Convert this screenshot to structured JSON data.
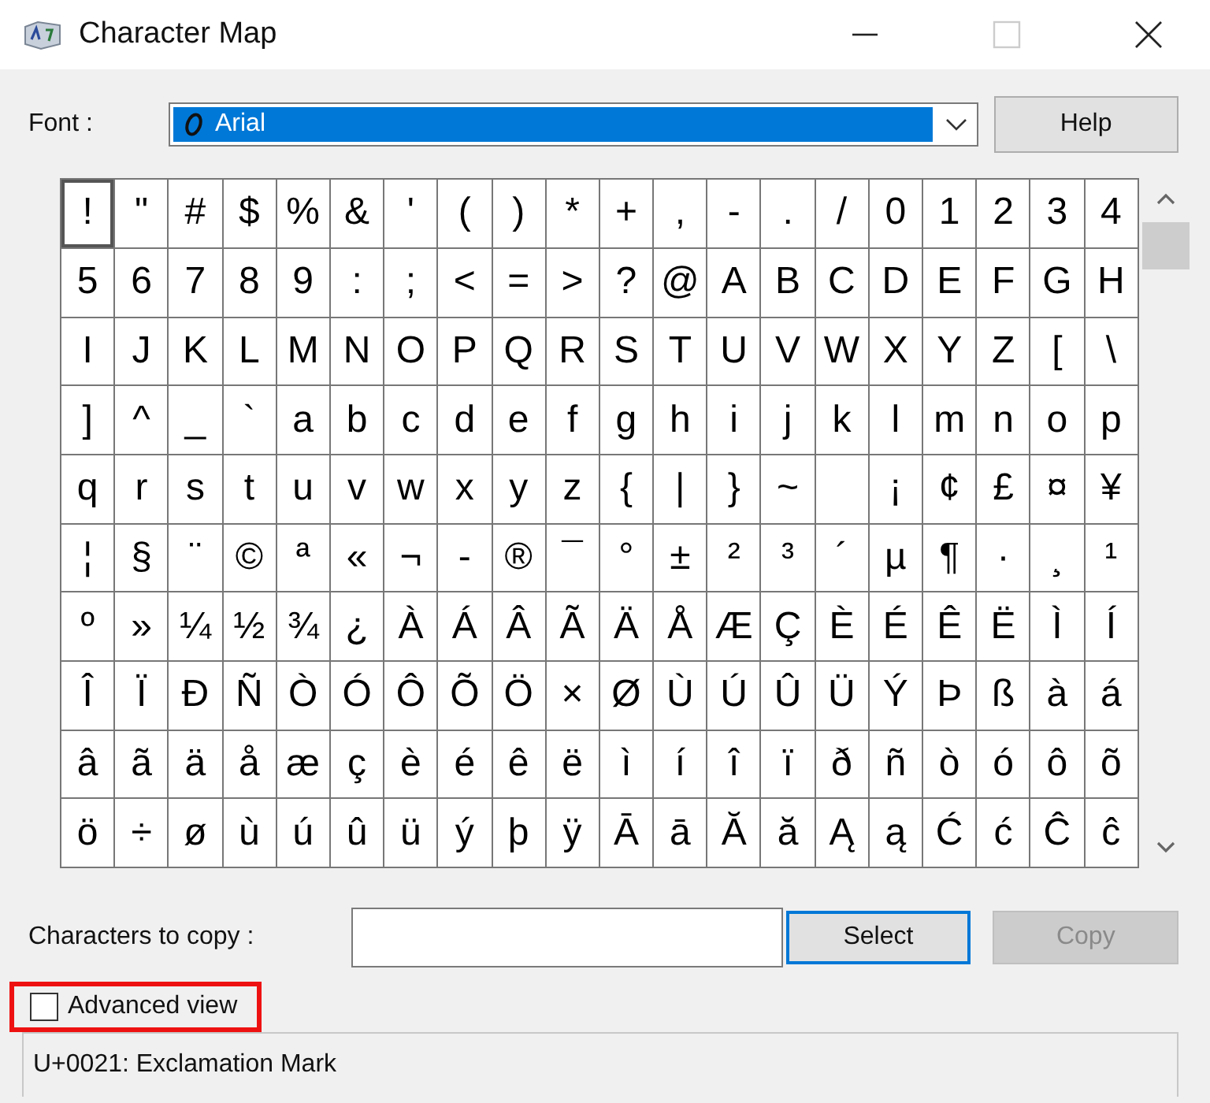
{
  "window": {
    "title": "Character Map"
  },
  "font": {
    "label": "Font :",
    "value": "Arial",
    "highlighted": true
  },
  "help_button": "Help",
  "grid": [
    [
      {
        "c": "!",
        "selected": true
      },
      {
        "c": "\"",
        "selected": false
      },
      {
        "c": "#",
        "selected": false
      },
      {
        "c": "$",
        "selected": false
      },
      {
        "c": "%",
        "selected": false
      },
      {
        "c": "&",
        "selected": false
      },
      {
        "c": "'",
        "selected": false
      },
      {
        "c": "(",
        "selected": false
      },
      {
        "c": ")",
        "selected": false
      },
      {
        "c": "*",
        "selected": false
      },
      {
        "c": "+",
        "selected": false
      },
      {
        "c": ",",
        "selected": false
      },
      {
        "c": "-",
        "selected": false
      },
      {
        "c": ".",
        "selected": false
      },
      {
        "c": "/",
        "selected": false
      },
      {
        "c": "0",
        "selected": false
      },
      {
        "c": "1",
        "selected": false
      },
      {
        "c": "2",
        "selected": false
      },
      {
        "c": "3",
        "selected": false
      },
      {
        "c": "4",
        "selected": false
      }
    ],
    [
      {
        "c": "5",
        "selected": false
      },
      {
        "c": "6",
        "selected": false
      },
      {
        "c": "7",
        "selected": false
      },
      {
        "c": "8",
        "selected": false
      },
      {
        "c": "9",
        "selected": false
      },
      {
        "c": ":",
        "selected": false
      },
      {
        "c": ";",
        "selected": false
      },
      {
        "c": "<",
        "selected": false
      },
      {
        "c": "=",
        "selected": false
      },
      {
        "c": ">",
        "selected": false
      },
      {
        "c": "?",
        "selected": false
      },
      {
        "c": "@",
        "selected": false
      },
      {
        "c": "A",
        "selected": false
      },
      {
        "c": "B",
        "selected": false
      },
      {
        "c": "C",
        "selected": false
      },
      {
        "c": "D",
        "selected": false
      },
      {
        "c": "E",
        "selected": false
      },
      {
        "c": "F",
        "selected": false
      },
      {
        "c": "G",
        "selected": false
      },
      {
        "c": "H",
        "selected": false
      }
    ],
    [
      {
        "c": "I",
        "selected": false
      },
      {
        "c": "J",
        "selected": false
      },
      {
        "c": "K",
        "selected": false
      },
      {
        "c": "L",
        "selected": false
      },
      {
        "c": "M",
        "selected": false
      },
      {
        "c": "N",
        "selected": false
      },
      {
        "c": "O",
        "selected": false
      },
      {
        "c": "P",
        "selected": false
      },
      {
        "c": "Q",
        "selected": false
      },
      {
        "c": "R",
        "selected": false
      },
      {
        "c": "S",
        "selected": false
      },
      {
        "c": "T",
        "selected": false
      },
      {
        "c": "U",
        "selected": false
      },
      {
        "c": "V",
        "selected": false
      },
      {
        "c": "W",
        "selected": false
      },
      {
        "c": "X",
        "selected": false
      },
      {
        "c": "Y",
        "selected": false
      },
      {
        "c": "Z",
        "selected": false
      },
      {
        "c": "[",
        "selected": false
      },
      {
        "c": "\\",
        "selected": false
      }
    ],
    [
      {
        "c": "]",
        "selected": false
      },
      {
        "c": "^",
        "selected": false
      },
      {
        "c": "_",
        "selected": false
      },
      {
        "c": "`",
        "selected": false
      },
      {
        "c": "a",
        "selected": false
      },
      {
        "c": "b",
        "selected": false
      },
      {
        "c": "c",
        "selected": false
      },
      {
        "c": "d",
        "selected": false
      },
      {
        "c": "e",
        "selected": false
      },
      {
        "c": "f",
        "selected": false
      },
      {
        "c": "g",
        "selected": false
      },
      {
        "c": "h",
        "selected": false
      },
      {
        "c": "i",
        "selected": false
      },
      {
        "c": "j",
        "selected": false
      },
      {
        "c": "k",
        "selected": false
      },
      {
        "c": "l",
        "selected": false
      },
      {
        "c": "m",
        "selected": false
      },
      {
        "c": "n",
        "selected": false
      },
      {
        "c": "o",
        "selected": false
      },
      {
        "c": "p",
        "selected": false
      }
    ],
    [
      {
        "c": "q",
        "selected": false
      },
      {
        "c": "r",
        "selected": false
      },
      {
        "c": "s",
        "selected": false
      },
      {
        "c": "t",
        "selected": false
      },
      {
        "c": "u",
        "selected": false
      },
      {
        "c": "v",
        "selected": false
      },
      {
        "c": "w",
        "selected": false
      },
      {
        "c": "x",
        "selected": false
      },
      {
        "c": "y",
        "selected": false
      },
      {
        "c": "z",
        "selected": false
      },
      {
        "c": "{",
        "selected": false
      },
      {
        "c": "|",
        "selected": false
      },
      {
        "c": "}",
        "selected": false
      },
      {
        "c": "~",
        "selected": false
      },
      {
        "selected": false
      },
      {
        "c": "¡",
        "selected": false
      },
      {
        "c": "¢",
        "selected": false
      },
      {
        "c": "£",
        "selected": false
      },
      {
        "c": "¤",
        "selected": false
      },
      {
        "c": "¥",
        "selected": false
      }
    ],
    [
      {
        "c": "¦",
        "selected": false
      },
      {
        "c": "§",
        "selected": false
      },
      {
        "c": "¨",
        "selected": false
      },
      {
        "c": "©",
        "selected": false
      },
      {
        "c": "ª",
        "selected": false
      },
      {
        "c": "«",
        "selected": false
      },
      {
        "c": "¬",
        "selected": false
      },
      {
        "c": "-",
        "selected": false
      },
      {
        "c": "®",
        "selected": false
      },
      {
        "c": "¯",
        "selected": false
      },
      {
        "c": "°",
        "selected": false
      },
      {
        "c": "±",
        "selected": false
      },
      {
        "c": "²",
        "selected": false
      },
      {
        "c": "³",
        "selected": false
      },
      {
        "c": "´",
        "selected": false
      },
      {
        "c": "µ",
        "selected": false
      },
      {
        "c": "¶",
        "selected": false
      },
      {
        "c": "·",
        "selected": false
      },
      {
        "c": "¸",
        "selected": false
      },
      {
        "c": "¹",
        "selected": false
      }
    ],
    [
      {
        "c": "º",
        "selected": false
      },
      {
        "c": "»",
        "selected": false
      },
      {
        "c": "¼",
        "selected": false
      },
      {
        "c": "½",
        "selected": false
      },
      {
        "c": "¾",
        "selected": false
      },
      {
        "c": "¿",
        "selected": false
      },
      {
        "c": "À",
        "selected": false
      },
      {
        "c": "Á",
        "selected": false
      },
      {
        "c": "Â",
        "selected": false
      },
      {
        "c": "Ã",
        "selected": false
      },
      {
        "c": "Ä",
        "selected": false
      },
      {
        "c": "Å",
        "selected": false
      },
      {
        "c": "Æ",
        "selected": false
      },
      {
        "c": "Ç",
        "selected": false
      },
      {
        "c": "È",
        "selected": false
      },
      {
        "c": "É",
        "selected": false
      },
      {
        "c": "Ê",
        "selected": false
      },
      {
        "c": "Ë",
        "selected": false
      },
      {
        "c": "Ì",
        "selected": false
      },
      {
        "c": "Í",
        "selected": false
      }
    ],
    [
      {
        "c": "Î",
        "selected": false
      },
      {
        "c": "Ï",
        "selected": false
      },
      {
        "c": "Ð",
        "selected": false
      },
      {
        "c": "Ñ",
        "selected": false
      },
      {
        "c": "Ò",
        "selected": false
      },
      {
        "c": "Ó",
        "selected": false
      },
      {
        "c": "Ô",
        "selected": false
      },
      {
        "c": "Õ",
        "selected": false
      },
      {
        "c": "Ö",
        "selected": false
      },
      {
        "c": "×",
        "selected": false
      },
      {
        "c": "Ø",
        "selected": false
      },
      {
        "c": "Ù",
        "selected": false
      },
      {
        "c": "Ú",
        "selected": false
      },
      {
        "c": "Û",
        "selected": false
      },
      {
        "c": "Ü",
        "selected": false
      },
      {
        "c": "Ý",
        "selected": false
      },
      {
        "c": "Þ",
        "selected": false
      },
      {
        "c": "ß",
        "selected": false
      },
      {
        "c": "à",
        "selected": false
      },
      {
        "c": "á",
        "selected": false
      }
    ],
    [
      {
        "c": "â",
        "selected": false
      },
      {
        "c": "ã",
        "selected": false
      },
      {
        "c": "ä",
        "selected": false
      },
      {
        "c": "å",
        "selected": false
      },
      {
        "c": "æ",
        "selected": false
      },
      {
        "c": "ç",
        "selected": false
      },
      {
        "c": "è",
        "selected": false
      },
      {
        "c": "é",
        "selected": false
      },
      {
        "c": "ê",
        "selected": false
      },
      {
        "c": "ë",
        "selected": false
      },
      {
        "c": "ì",
        "selected": false
      },
      {
        "c": "í",
        "selected": false
      },
      {
        "c": "î",
        "selected": false
      },
      {
        "c": "ï",
        "selected": false
      },
      {
        "c": "ð",
        "selected": false
      },
      {
        "c": "ñ",
        "selected": false
      },
      {
        "c": "ò",
        "selected": false
      },
      {
        "c": "ó",
        "selected": false
      },
      {
        "c": "ô",
        "selected": false
      },
      {
        "c": "õ",
        "selected": false
      }
    ],
    [
      {
        "c": "ö",
        "selected": false
      },
      {
        "c": "÷",
        "selected": false
      },
      {
        "c": "ø",
        "selected": false
      },
      {
        "c": "ù",
        "selected": false
      },
      {
        "c": "ú",
        "selected": false
      },
      {
        "c": "û",
        "selected": false
      },
      {
        "c": "ü",
        "selected": false
      },
      {
        "c": "ý",
        "selected": false
      },
      {
        "c": "þ",
        "selected": false
      },
      {
        "c": "ÿ",
        "selected": false
      },
      {
        "c": "Ā",
        "selected": false
      },
      {
        "c": "ā",
        "selected": false
      },
      {
        "c": "Ă",
        "selected": false
      },
      {
        "c": "ă",
        "selected": false
      },
      {
        "c": "Ą",
        "selected": false
      },
      {
        "c": "ą",
        "selected": false
      },
      {
        "c": "Ć",
        "selected": false
      },
      {
        "c": "ć",
        "selected": false
      },
      {
        "c": "Ĉ",
        "selected": false
      },
      {
        "c": "ĉ",
        "selected": false
      }
    ]
  ],
  "copy_row": {
    "label": "Characters to copy :"
  },
  "buttons": [
    {
      "label": "Select",
      "focused": true,
      "disabled": false
    },
    {
      "label": "Copy",
      "focused": false,
      "disabled": true
    }
  ],
  "advanced_view": {
    "label": "Advanced view",
    "checked": false,
    "highlighted": true
  },
  "status_bar": "U+0021: Exclamation Mark"
}
